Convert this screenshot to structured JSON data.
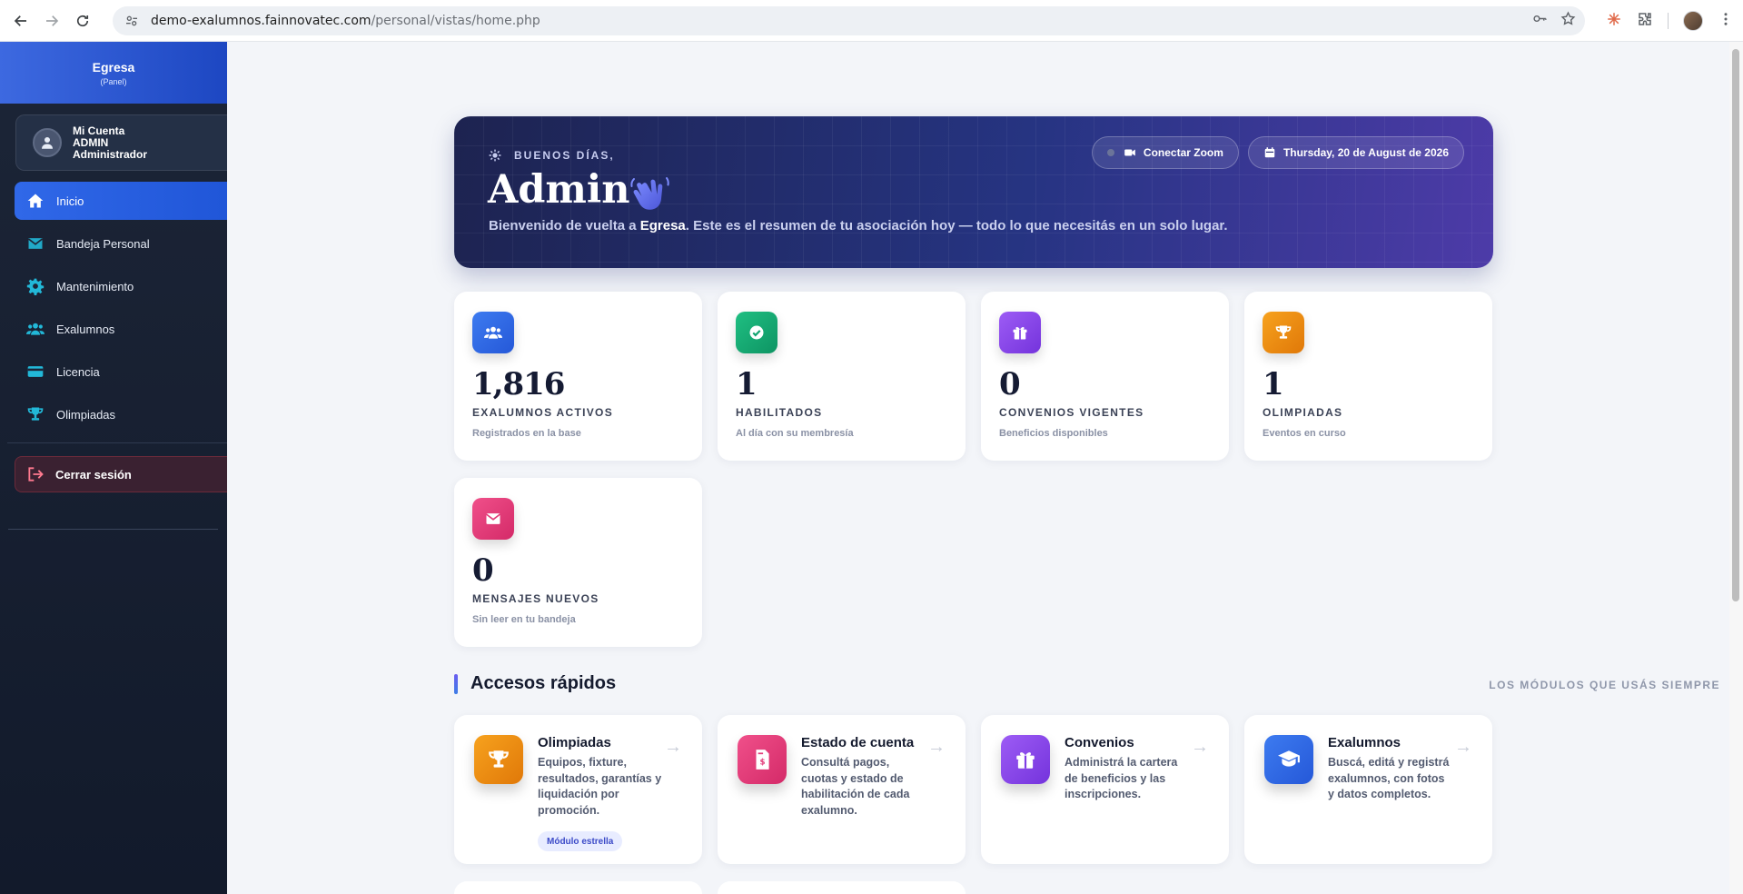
{
  "browser": {
    "url_host": "demo-exalumnos.fainnovatec.com",
    "url_path": "/personal/vistas/home.php"
  },
  "sidebar": {
    "brand": "Egresa",
    "brand_sub": "(Panel)",
    "account": {
      "line1": "Mi Cuenta",
      "line2": "ADMIN",
      "line3": "Administrador"
    },
    "items": [
      {
        "label": "Inicio",
        "icon": "home-icon",
        "active": true
      },
      {
        "label": "Bandeja Personal",
        "icon": "envelope-icon"
      },
      {
        "label": "Mantenimiento",
        "icon": "gear-icon"
      },
      {
        "label": "Exalumnos",
        "icon": "users-icon"
      },
      {
        "label": "Licencia",
        "icon": "credit-card-icon"
      },
      {
        "label": "Olimpiadas",
        "icon": "trophy-icon"
      }
    ],
    "logout": "Cerrar sesión"
  },
  "hero": {
    "greeting": "BUENOS DÍAS,",
    "name": "Admin",
    "subtitle_pre": "Bienvenido de vuelta a ",
    "subtitle_brand": "Egresa",
    "subtitle_post": ". Este es el resumen de tu asociación hoy — todo lo que necesitás en un solo lugar.",
    "zoom_button": "Conectar Zoom",
    "date": "Thursday, 20 de August de 2026"
  },
  "stats": [
    {
      "value": "1,816",
      "label": "EXALUMNOS ACTIVOS",
      "sub": "Registrados en la base",
      "icon": "users-icon",
      "color": "#2f6ae8"
    },
    {
      "value": "1",
      "label": "HABILITADOS",
      "sub": "Al día con su membresía",
      "icon": "check-circle-icon",
      "color": "#12a36f"
    },
    {
      "value": "0",
      "label": "CONVENIOS VIGENTES",
      "sub": "Beneficios disponibles",
      "icon": "gift-icon",
      "color": "#8a44e8"
    },
    {
      "value": "1",
      "label": "OLIMPIADAS",
      "sub": "Eventos en curso",
      "icon": "trophy-icon",
      "color": "#f08a0c"
    },
    {
      "value": "0",
      "label": "MENSAJES NUEVOS",
      "sub": "Sin leer en tu bandeja",
      "icon": "envelope-icon",
      "color": "#e23c7a"
    }
  ],
  "quick": {
    "title": "Accesos rápidos",
    "note": "LOS MÓDULOS QUE USÁS SIEMPRE",
    "cards": [
      {
        "title": "Olimpiadas",
        "desc": "Equipos, fixture, resultados, garantías y liquidación por promoción.",
        "badge": "Módulo estrella",
        "icon": "trophy-icon",
        "color": "#f08a0c"
      },
      {
        "title": "Estado de cuenta",
        "desc": "Consultá pagos, cuotas y estado de habilitación de cada exalumno.",
        "icon": "invoice-icon",
        "color": "#e23c7a"
      },
      {
        "title": "Convenios",
        "desc": "Administrá la cartera de beneficios y las inscripciones.",
        "icon": "gift-icon",
        "color": "#8a44e8"
      },
      {
        "title": "Exalumnos",
        "desc": "Buscá, editá y registrá exalumnos, con fotos y datos completos.",
        "icon": "graduate-icon",
        "color": "#2f6ae8"
      }
    ],
    "arrow": "→"
  }
}
